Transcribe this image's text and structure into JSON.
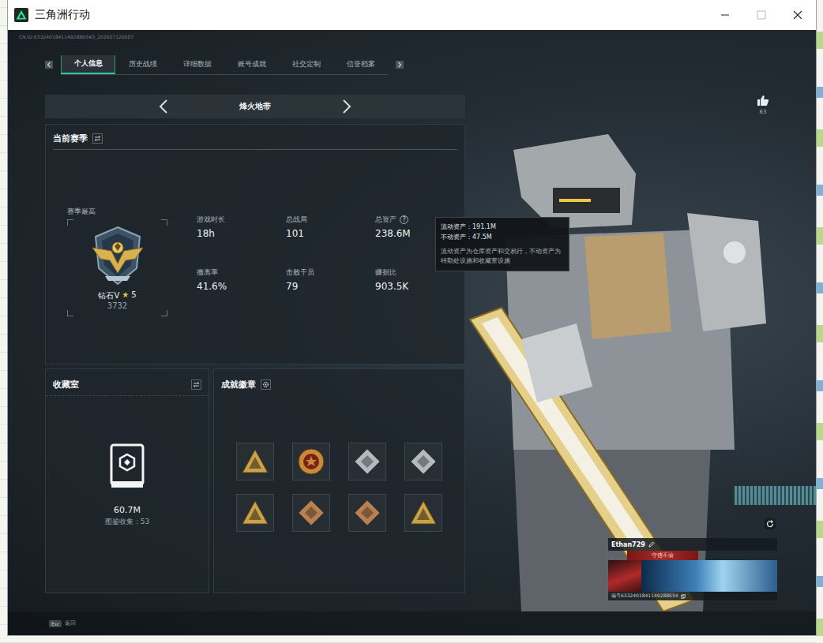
{
  "window": {
    "title": "三角洲行动"
  },
  "header": {
    "id_line": "CN ID:6332401841149288654O_202607120007"
  },
  "tabs": [
    {
      "label": "个人信息",
      "selected": true
    },
    {
      "label": "历史战绩",
      "selected": false
    },
    {
      "label": "详细数据",
      "selected": false
    },
    {
      "label": "账号成就",
      "selected": false
    },
    {
      "label": "社交定制",
      "selected": false
    },
    {
      "label": "信誉档案",
      "selected": false
    }
  ],
  "mode": {
    "label": "烽火地带"
  },
  "season": {
    "title": "当前赛季",
    "best_label": "赛季最高",
    "rank": "钻石V",
    "star": "★",
    "star_count": "5",
    "score": "3732"
  },
  "stats": [
    {
      "label": "游戏时长",
      "value": "18h"
    },
    {
      "label": "总战局",
      "value": "101"
    },
    {
      "label": "总资产",
      "value": "238.6M",
      "help": "?"
    },
    {
      "label": "撤离率",
      "value": "41.6%"
    },
    {
      "label": "击败干员",
      "value": "79"
    },
    {
      "label": "赚损比",
      "value": "903.5K"
    }
  ],
  "tooltip": {
    "lines": [
      "流动资产：191.1M",
      "不动资产：47.5M"
    ],
    "note": "流动资产为仓库资产和交易行，不动资产为特勤处设施和收藏室设施"
  },
  "collection": {
    "title": "收藏室",
    "value": "60.7M",
    "caption": "图鉴收集：53"
  },
  "badges": {
    "title": "成就徽章",
    "items": [
      {
        "kind": "triangle",
        "color": "#c9a24a"
      },
      {
        "kind": "round",
        "color": "#c98a3a"
      },
      {
        "kind": "diamond",
        "color": "#b4b9be"
      },
      {
        "kind": "diamond",
        "color": "#b4b9be"
      },
      {
        "kind": "triangle",
        "color": "#c9a24a"
      },
      {
        "kind": "diamond",
        "color": "#b9804e"
      },
      {
        "kind": "diamond",
        "color": "#b9804e"
      },
      {
        "kind": "triangle",
        "color": "#c9a24a"
      }
    ]
  },
  "likes": {
    "count": "63"
  },
  "player": {
    "name": "Ethan729",
    "title": "守信不渝",
    "id": "编号6332401841149288654"
  },
  "footer": {
    "key": "Esc",
    "label": "返回"
  }
}
